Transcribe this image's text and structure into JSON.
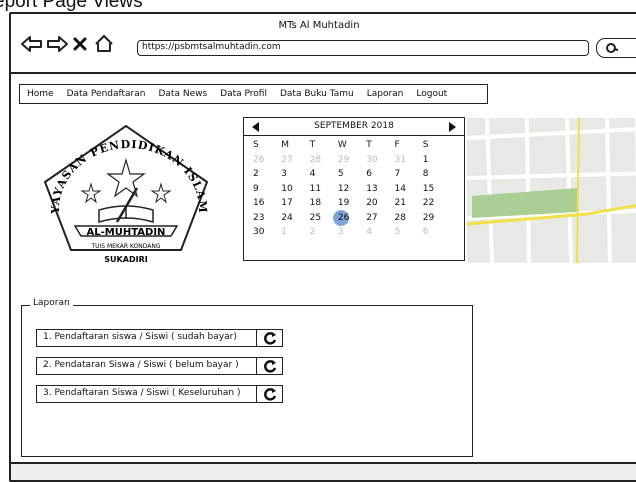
{
  "page_heading": "eport Page Views",
  "window": {
    "title": "MTs Al Muhtadin"
  },
  "browser": {
    "url": "https://psbmtsalmuhtadin.com"
  },
  "menu": [
    "Home",
    "Data Pendaftaran",
    "Data News",
    "Data Profil",
    "Data Buku Tamu",
    "Laporan",
    "Logout"
  ],
  "logo": {
    "top_text": "YAYASAN PENDIDIKAN ISLAM",
    "banner": "AL-MUHTADIN",
    "line1": "TUIS MEKAR KONDANG",
    "line2": "SUKADIRI"
  },
  "calendar": {
    "month_label": "SEPTEMBER 2018",
    "weekdays": [
      "S",
      "M",
      "T",
      "W",
      "T",
      "F",
      "S"
    ],
    "days": [
      [
        "26",
        "27",
        "28",
        "29",
        "30",
        "31",
        "1"
      ],
      [
        "2",
        "3",
        "4",
        "5",
        "6",
        "7",
        "8"
      ],
      [
        "9",
        "10",
        "11",
        "12",
        "13",
        "14",
        "15"
      ],
      [
        "16",
        "17",
        "18",
        "19",
        "20",
        "21",
        "22"
      ],
      [
        "23",
        "24",
        "25",
        "26",
        "27",
        "28",
        "29"
      ],
      [
        "30",
        "1",
        "2",
        "3",
        "4",
        "5",
        "6"
      ]
    ],
    "selected_day": "26"
  },
  "laporan": {
    "legend": "Laporan",
    "items": [
      "1. Pendaftaran siswa / Siswi ( sudah bayar)",
      "2. Pendataran Siswa / Siswi ( belum bayar )",
      "3. Pendaftaran Siswa / Siswi ( Keseluruhan )"
    ]
  },
  "icons": {
    "back": "arrow-left-icon",
    "forward": "arrow-right-icon",
    "stop": "close-icon",
    "home": "home-icon",
    "search": "search-icon",
    "print": "refresh-icon"
  }
}
